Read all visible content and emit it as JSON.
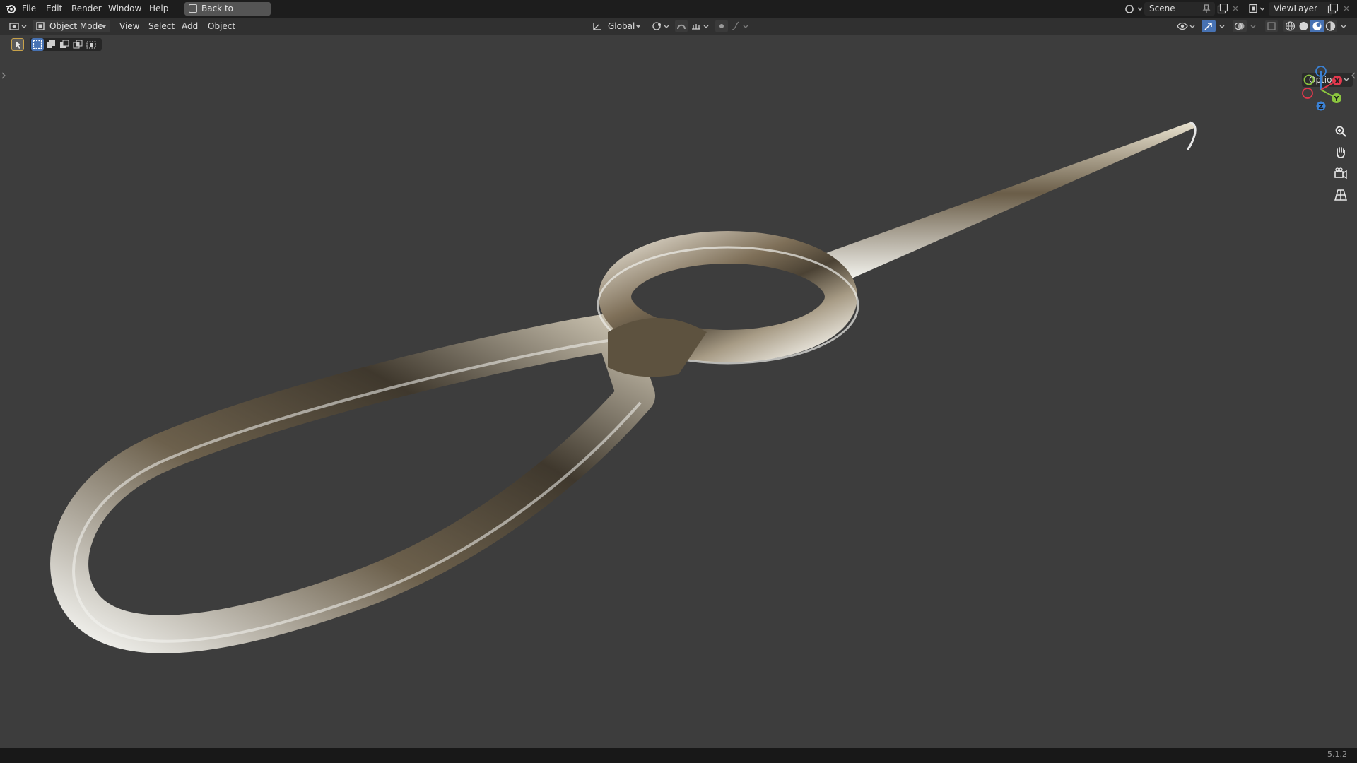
{
  "menu": {
    "file": "File",
    "edit": "Edit",
    "render": "Render",
    "window": "Window",
    "help": "Help",
    "back_to_previous": "Back to Previous"
  },
  "scene": {
    "name": "Scene",
    "view_layer": "ViewLayer"
  },
  "header": {
    "mode": "Object Mode",
    "view": "View",
    "select": "Select",
    "add": "Add",
    "object": "Object",
    "orientation": "Global"
  },
  "viewport": {
    "options_label": "Options",
    "gizmo": {
      "x": "X",
      "y": "Y",
      "z": "Z"
    }
  },
  "status": {
    "version": "5.1.2"
  },
  "icons": {
    "blender": "blender-logo-icon",
    "back": "back-icon",
    "editor_type": "editor-type-icon",
    "mode": "object-mode-icon",
    "transform": "transform-orientation-icon",
    "pivot": "pivot-icon",
    "snap": "snap-icon",
    "proportional": "proportional-editing-icon",
    "zoom": "zoom-icon",
    "pan": "hand-icon",
    "camera": "camera-icon",
    "perspective": "grid-perspective-icon"
  },
  "colors": {
    "background": "#3d3d3d",
    "topbar": "#1d1d1d",
    "header": "#303030",
    "accent": "#4772b3",
    "axis_x": "#e2384d",
    "axis_y": "#8bc53f",
    "axis_z": "#3b82d6"
  }
}
